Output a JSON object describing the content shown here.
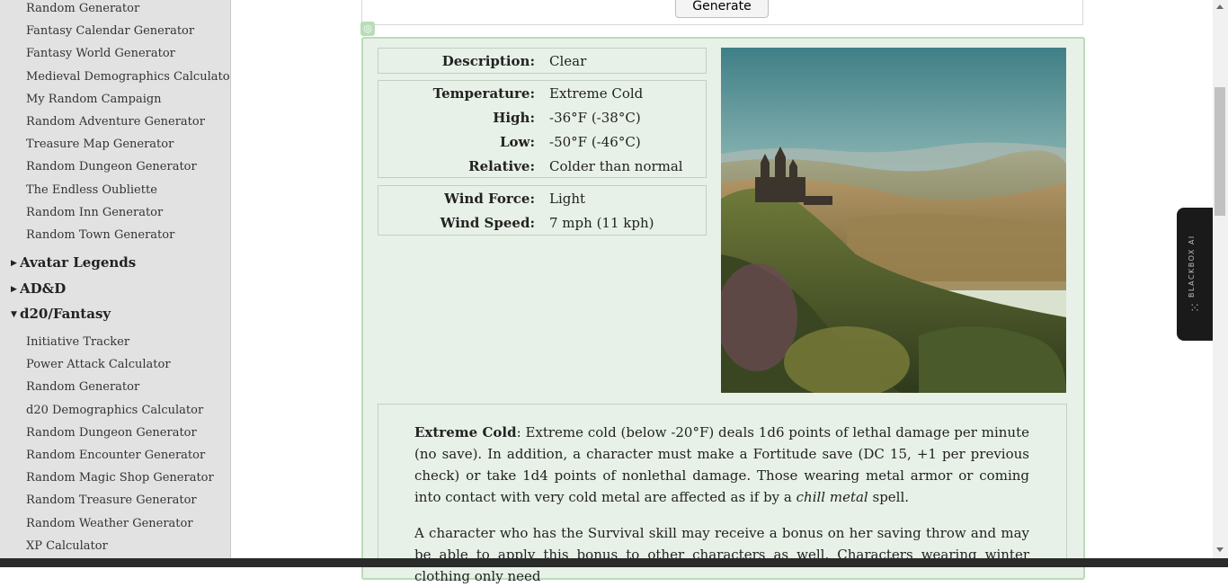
{
  "sidebar": {
    "links_top": [
      "Random Generator",
      "Fantasy Calendar Generator",
      "Fantasy World Generator",
      "Medieval Demographics Calculator",
      "My Random Campaign",
      "Random Adventure Generator",
      "Treasure Map Generator",
      "Random Dungeon Generator",
      "The Endless Oubliette",
      "Random Inn Generator",
      "Random Town Generator"
    ],
    "groups": [
      {
        "label": "Avatar Legends",
        "expanded": false
      },
      {
        "label": "AD&D",
        "expanded": false
      },
      {
        "label": "d20/Fantasy",
        "expanded": true
      }
    ],
    "links_d20": [
      "Initiative Tracker",
      "Power Attack Calculator",
      "Random Generator",
      "d20 Demographics Calculator",
      "Random Dungeon Generator",
      "Random Encounter Generator",
      "Random Magic Shop Generator",
      "Random Treasure Generator",
      "Random Weather Generator",
      "XP Calculator"
    ]
  },
  "generate_button": "Generate",
  "weather": {
    "description": {
      "label": "Description:",
      "value": "Clear"
    },
    "temperature": {
      "label": "Temperature:",
      "value": "Extreme Cold",
      "high_label": "High:",
      "high": "-36°F (-38°C)",
      "low_label": "Low:",
      "low": "-50°F (-46°C)",
      "relative_label": "Relative:",
      "relative": "Colder than normal"
    },
    "wind": {
      "force_label": "Wind Force:",
      "force": "Light",
      "speed_label": "Wind Speed:",
      "speed": "7 mph (11 kph)"
    }
  },
  "effects": {
    "p1_title": "Extreme Cold",
    "p1_a": ": Extreme cold (below -20°F) deals 1d6 points of lethal damage per minute (no save). In addition, a character must make a Fortitude save (DC 15, +1 per previous check) or take 1d4 points of nonlethal damage. Those wearing metal armor or coming into contact with very cold metal are affected as if by a ",
    "p1_spell": "chill metal",
    "p1_b": " spell.",
    "p2": "A character who has the Survival skill may receive a bonus on her saving throw and may be able to apply this bonus to other characters as well. Characters wearing winter clothing only need"
  },
  "widget": {
    "label": "BLACKBOX AI"
  },
  "colors": {
    "panel_bg": "#e8f1e8",
    "panel_border": "#b9dcb9",
    "sidebar_bg": "#e2e2e2"
  }
}
